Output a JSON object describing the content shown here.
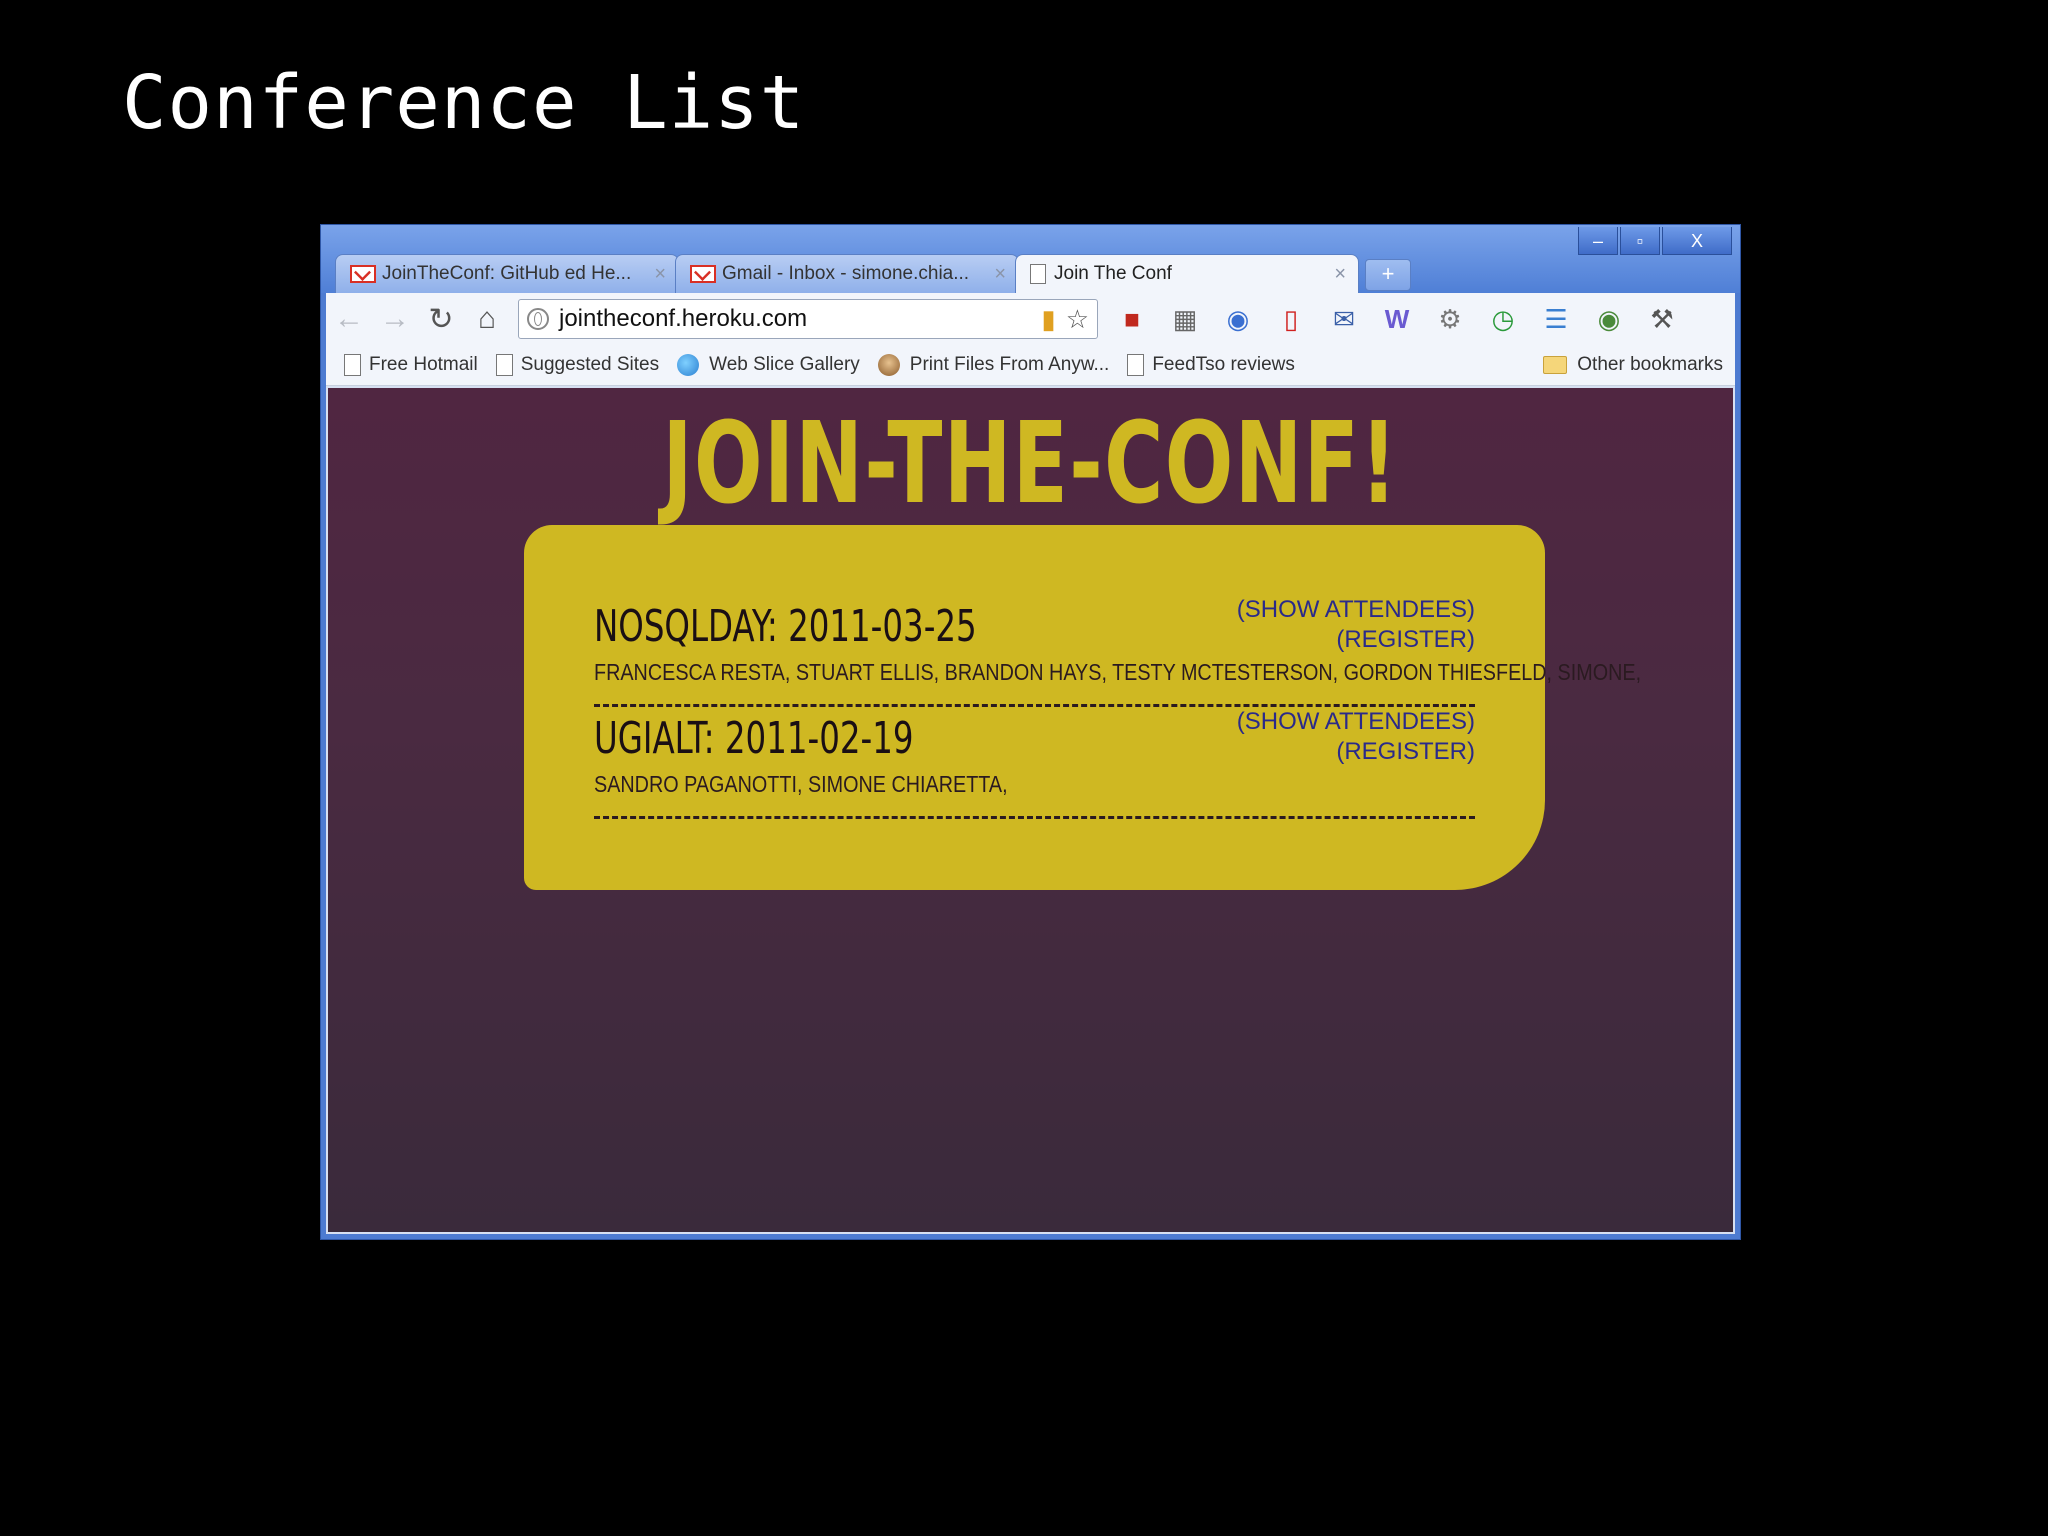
{
  "slide": {
    "title": "Conference List"
  },
  "browser": {
    "window_controls": {
      "minimize": "–",
      "maximize": "▫",
      "close": "X"
    },
    "tabs": [
      {
        "label": "JoinTheConf: GitHub ed He...",
        "icon": "gmail-icon",
        "active": false
      },
      {
        "label": "Gmail - Inbox - simone.chia...",
        "icon": "gmail-icon",
        "active": false
      },
      {
        "label": "Join The Conf",
        "icon": "page-icon",
        "active": true
      }
    ],
    "new_tab": "+",
    "close_glyph": "×",
    "address": {
      "url": "jointheconf.heroku.com"
    },
    "bookmarks": [
      {
        "label": "Free Hotmail",
        "icon": "page-icon"
      },
      {
        "label": "Suggested Sites",
        "icon": "page-icon"
      },
      {
        "label": "Web Slice Gallery",
        "icon": "ie-icon"
      },
      {
        "label": "Print Files From Anyw...",
        "icon": "face-icon"
      },
      {
        "label": "FeedTso reviews",
        "icon": "page-icon"
      }
    ],
    "other_bookmarks": "Other bookmarks"
  },
  "site": {
    "title": "JOIN-THE-CONF!",
    "conferences": [
      {
        "name": "NOSQLDAY: 2011-03-25",
        "attendees": "FRANCESCA RESTA, STUART ELLIS, BRANDON HAYS, TESTY MCTESTERSON, GORDON THIESFELD, SIMONE,",
        "show_attendees": "(SHOW ATTENDEES)",
        "register": "(REGISTER)"
      },
      {
        "name": "UGIALT: 2011-02-19",
        "attendees": "SANDRO PAGANOTTI, SIMONE CHIARETTA,",
        "show_attendees": "(SHOW ATTENDEES)",
        "register": "(REGISTER)"
      }
    ]
  },
  "colors": {
    "page_bg": "#502641",
    "card_bg": "#cfb822",
    "title_color": "#cfb822",
    "link_color": "#2a2a8a"
  }
}
